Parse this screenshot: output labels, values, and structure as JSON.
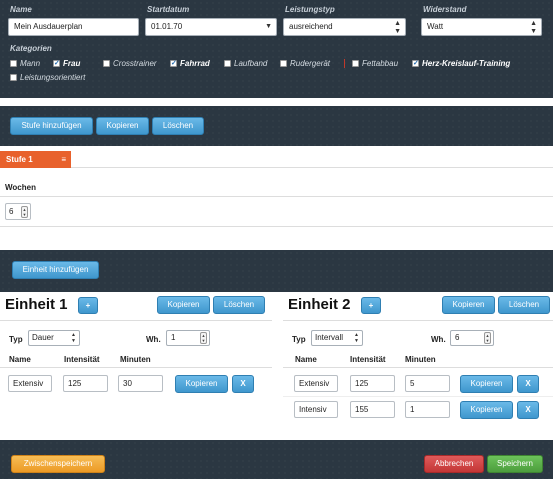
{
  "top": {
    "name_label": "Name",
    "name_value": "Mein Ausdauerplan",
    "start_label": "Startdatum",
    "start_value": "01.01.70",
    "type_label": "Leistungstyp",
    "type_value": "ausreichend",
    "resist_label": "Widerstand",
    "resist_value": "Watt",
    "categories_label": "Kategorien",
    "categories": [
      {
        "label": "Mann",
        "checked": false
      },
      {
        "label": "Frau",
        "checked": true
      },
      {
        "label": "Crosstrainer",
        "checked": false
      },
      {
        "label": "Fahrrad",
        "checked": true
      },
      {
        "label": "Laufband",
        "checked": false
      },
      {
        "label": "Rudergerät",
        "checked": false
      },
      {
        "label": "Fettabbau",
        "checked": false
      },
      {
        "label": "Herz-Kreislauf-Training",
        "checked": true
      },
      {
        "label": "Leistungsorientiert",
        "checked": false
      }
    ]
  },
  "stage_toolbar": {
    "add": "Stufe hinzufügen",
    "copy": "Kopieren",
    "delete": "Löschen"
  },
  "stage": {
    "tab_label": "Stufe 1",
    "weeks_label": "Wochen",
    "weeks_value": "6"
  },
  "unit_toolbar": {
    "add": "Einheit hinzufügen"
  },
  "units": [
    {
      "title": "Einheit 1",
      "plus": "+",
      "copy": "Kopieren",
      "delete": "Löschen",
      "type_label": "Typ",
      "type_value": "Dauer",
      "wh_label": "Wh.",
      "wh_value": "1",
      "col_name": "Name",
      "col_intensity": "Intensität",
      "col_minutes": "Minuten",
      "rows": [
        {
          "name": "Extensiv",
          "intensity": "125",
          "minutes": "30",
          "copy": "Kopieren",
          "remove": "X"
        }
      ]
    },
    {
      "title": "Einheit 2",
      "plus": "+",
      "copy": "Kopieren",
      "delete": "Löschen",
      "type_label": "Typ",
      "type_value": "Intervall",
      "wh_label": "Wh.",
      "wh_value": "6",
      "col_name": "Name",
      "col_intensity": "Intensität",
      "col_minutes": "Minuten",
      "rows": [
        {
          "name": "Extensiv",
          "intensity": "125",
          "minutes": "5",
          "copy": "Kopieren",
          "remove": "X"
        },
        {
          "name": "Intensiv",
          "intensity": "155",
          "minutes": "1",
          "copy": "Kopieren",
          "remove": "X"
        }
      ]
    }
  ],
  "footer": {
    "save_temp": "Zwischenspeichern",
    "cancel": "Abbrechen",
    "save": "Speichern"
  },
  "colors": {
    "dark_bg": "#2b3742",
    "accent_blue": "#4aa3d8",
    "tab_orange": "#e8612c",
    "save_temp_orange": "#f0a030",
    "cancel_red": "#cc3b3b",
    "save_green": "#55a845"
  }
}
